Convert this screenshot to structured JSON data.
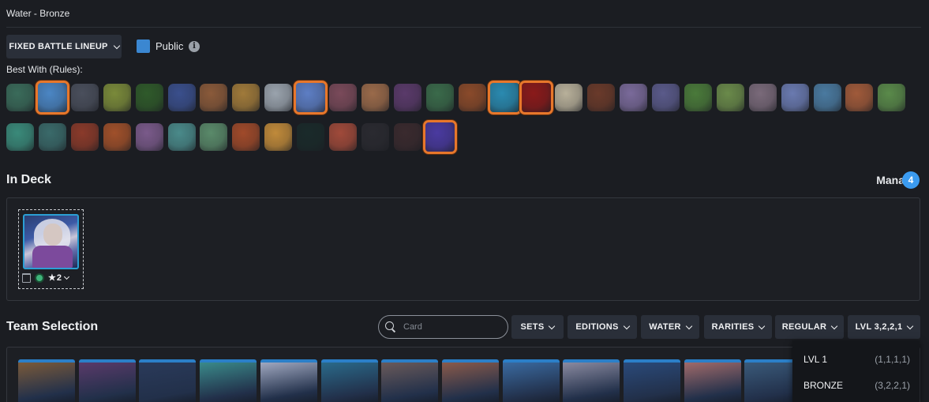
{
  "header": {
    "title": "Water - Bronze"
  },
  "controls": {
    "lineup_label": "FIXED BATTLE LINEUP",
    "public_label": "Public",
    "public_checked": true,
    "info_glyph": "i"
  },
  "rules": {
    "label": "Best With (Rules):",
    "icons": [
      {
        "name": "goblin-brawler-rule-icon",
        "color": "#3a6b5a",
        "selected": false
      },
      {
        "name": "even-odd-cards-rule-icon",
        "color": "#4b86c4",
        "selected": true
      },
      {
        "name": "hooded-silhouette-rule-icon",
        "color": "#4a4f5c",
        "selected": false
      },
      {
        "name": "target-rule-icon",
        "color": "#7a8a3a",
        "selected": false
      },
      {
        "name": "poison-fog-rule-icon",
        "color": "#2f5a2a",
        "selected": false
      },
      {
        "name": "lightning-rule-icon",
        "color": "#3a4f8c",
        "selected": false
      },
      {
        "name": "armored-shield-rule-icon",
        "color": "#8a5a3a",
        "selected": false
      },
      {
        "name": "holy-fist-rule-icon",
        "color": "#a07a3a",
        "selected": false
      },
      {
        "name": "cloud-rule-icon",
        "color": "#9aa3ad",
        "selected": false
      },
      {
        "name": "horned-helmet-rule-icon",
        "color": "#5d7ec4",
        "selected": true
      },
      {
        "name": "bandage-rule-icon",
        "color": "#7a4a5a",
        "selected": false
      },
      {
        "name": "hands-rule-icon",
        "color": "#9a6a4a",
        "selected": false
      },
      {
        "name": "eye-beam-rule-icon",
        "color": "#5a3a6a",
        "selected": false
      },
      {
        "name": "raptor-rule-icon",
        "color": "#3a6a4a",
        "selected": false
      },
      {
        "name": "broken-tower-rule-icon",
        "color": "#8a4a2a",
        "selected": false
      },
      {
        "name": "heart-boost-rule-icon",
        "color": "#2a8ab0",
        "selected": true
      },
      {
        "name": "melee-weapons-rule-icon",
        "color": "#8a1a1a",
        "selected": true
      },
      {
        "name": "ghost-rule-icon",
        "color": "#b8b09a",
        "selected": false
      },
      {
        "name": "hammer-rule-icon",
        "color": "#6a3a2a",
        "selected": false
      },
      {
        "name": "color-wheel-rule-icon",
        "color": "#7a6a9a",
        "selected": false
      },
      {
        "name": "crossed-blades-rule-icon",
        "color": "#5a5a8a",
        "selected": false
      },
      {
        "name": "goblin-rule-icon",
        "color": "#4a7a3a",
        "selected": false
      },
      {
        "name": "spark-warrior-rule-icon",
        "color": "#6a8a4a",
        "selected": false
      },
      {
        "name": "mage-rule-icon",
        "color": "#7a6a7a",
        "selected": false
      },
      {
        "name": "crystal-orb-rule-icon",
        "color": "#6a7ab0",
        "selected": false
      },
      {
        "name": "card-deck-rule-icon",
        "color": "#4a7aa0",
        "selected": false
      },
      {
        "name": "red-cards-rule-icon",
        "color": "#a05a3a",
        "selected": false
      },
      {
        "name": "swamp-rule-icon",
        "color": "#5a8a4a",
        "selected": false
      },
      {
        "name": "explosion-rule-icon",
        "color": "#3a8a7a",
        "selected": false
      },
      {
        "name": "watching-eye-rule-icon",
        "color": "#3a6a6a",
        "selected": false
      },
      {
        "name": "chains-rule-icon",
        "color": "#8a3a2a",
        "selected": false
      },
      {
        "name": "burst-rule-icon",
        "color": "#a0502a",
        "selected": false
      },
      {
        "name": "reflect-shield-rule-icon",
        "color": "#7a5a8a",
        "selected": false
      },
      {
        "name": "radiant-rule-icon",
        "color": "#4a8a8a",
        "selected": false
      },
      {
        "name": "lightning-staff-rule-icon",
        "color": "#5a8a6a",
        "selected": false
      },
      {
        "name": "beast-rule-icon",
        "color": "#a04a2a",
        "selected": false
      },
      {
        "name": "star-burst-rule-icon",
        "color": "#c08a3a",
        "selected": false
      },
      {
        "name": "diamond-rule-icon",
        "color": "#1a2a2a",
        "selected": false
      },
      {
        "name": "claw-rule-icon",
        "color": "#a04a3a",
        "selected": false
      },
      {
        "name": "barrage-rule-icon",
        "color": "#2a2a30",
        "selected": false
      },
      {
        "name": "bullseye-rule-icon",
        "color": "#3a2a2e",
        "selected": false
      },
      {
        "name": "blue-blob-rule-icon",
        "color": "#4a3aa0",
        "selected": true
      }
    ]
  },
  "deck": {
    "title": "In Deck",
    "mana_label": "Mana",
    "mana_value": "4",
    "card": {
      "name": "card-portrait",
      "level": "2"
    }
  },
  "team": {
    "title": "Team Selection",
    "search_placeholder": "Card",
    "filters": [
      {
        "label": "SETS",
        "name": "sets-filter-button"
      },
      {
        "label": "EDITIONS",
        "name": "editions-filter-button"
      },
      {
        "label": "WATER",
        "name": "water-filter-button"
      },
      {
        "label": "RARITIES",
        "name": "rarities-filter-button"
      },
      {
        "label": "REGULAR",
        "name": "regular-filter-button"
      },
      {
        "label": "LVL 3,2,2,1",
        "name": "level-filter-button"
      }
    ],
    "level_options": [
      {
        "label": "LVL 1",
        "values": "(1,1,1,1)"
      },
      {
        "label": "BRONZE",
        "values": "(3,2,2,1)"
      }
    ],
    "cards": [
      {
        "name": "card-thumb-1",
        "color": "#7a5a3a"
      },
      {
        "name": "card-thumb-2",
        "color": "#5a3a6a"
      },
      {
        "name": "card-thumb-3",
        "color": "#2a3a5a"
      },
      {
        "name": "card-thumb-4",
        "color": "#3a8a8a"
      },
      {
        "name": "card-thumb-5",
        "color": "#a0a8c0"
      },
      {
        "name": "card-thumb-6",
        "color": "#2a6a8a"
      },
      {
        "name": "card-thumb-7",
        "color": "#6a5a5a"
      },
      {
        "name": "card-thumb-8",
        "color": "#8a5a4a"
      },
      {
        "name": "card-thumb-9",
        "color": "#3a6aa0"
      },
      {
        "name": "card-thumb-10",
        "color": "#8a8aa0"
      },
      {
        "name": "card-thumb-11",
        "color": "#2a4a7a"
      },
      {
        "name": "card-thumb-12",
        "color": "#a06a6a"
      },
      {
        "name": "card-thumb-13",
        "color": "#3a5a7a"
      }
    ]
  }
}
